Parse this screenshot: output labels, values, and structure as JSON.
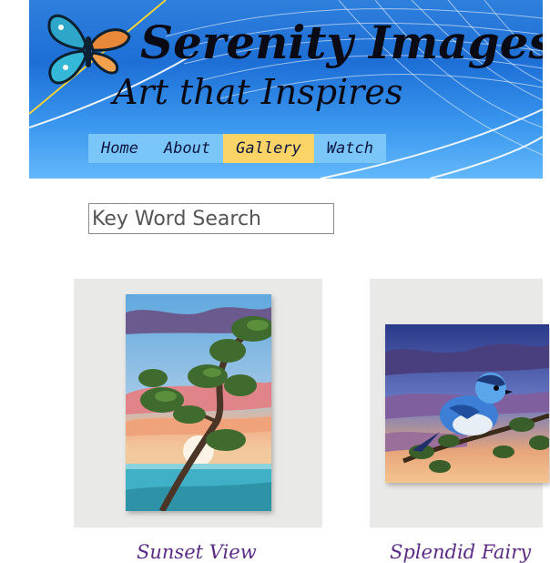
{
  "header": {
    "title": "Serenity Images",
    "tagline": "Art that Inspires"
  },
  "nav": {
    "items": [
      {
        "label": "Home",
        "active": false
      },
      {
        "label": "About",
        "active": false
      },
      {
        "label": "Gallery",
        "active": true
      },
      {
        "label": "Watch",
        "active": false
      }
    ]
  },
  "search": {
    "placeholder": "Key Word Search",
    "value": ""
  },
  "gallery": {
    "items": [
      {
        "caption": "Sunset View"
      },
      {
        "caption": "Splendid Fairy"
      }
    ]
  },
  "colors": {
    "nav_background": "#7ac6f9",
    "nav_active": "#fbd467",
    "caption_text": "#5b2a86"
  }
}
